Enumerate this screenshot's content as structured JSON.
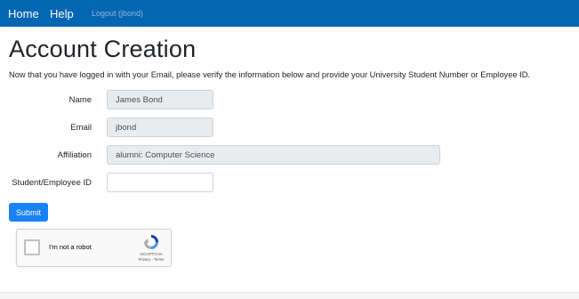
{
  "nav": {
    "home": "Home",
    "help": "Help",
    "logout": "Logout (jbond)"
  },
  "page": {
    "title": "Account Creation",
    "intro": "Now that you have logged in with your Email, please verify the information below and provide your University Student Number or Employee ID."
  },
  "form": {
    "name": {
      "label": "Name",
      "value": "James Bond"
    },
    "email": {
      "label": "Email",
      "value": "jbond"
    },
    "affiliation": {
      "label": "Affiliation",
      "value": "alumni: Computer Science"
    },
    "student_id": {
      "label": "Student/Employee ID",
      "value": ""
    },
    "submit_label": "Submit"
  },
  "recaptcha": {
    "label": "I'm not a robot",
    "brand": "reCAPTCHA",
    "terms": "Privacy - Terms",
    "icon": "recaptcha-logo-icon"
  },
  "colors": {
    "navbar": "#0366b2",
    "submit": "#1a82f7",
    "readonly_field": "#e9ecef"
  }
}
